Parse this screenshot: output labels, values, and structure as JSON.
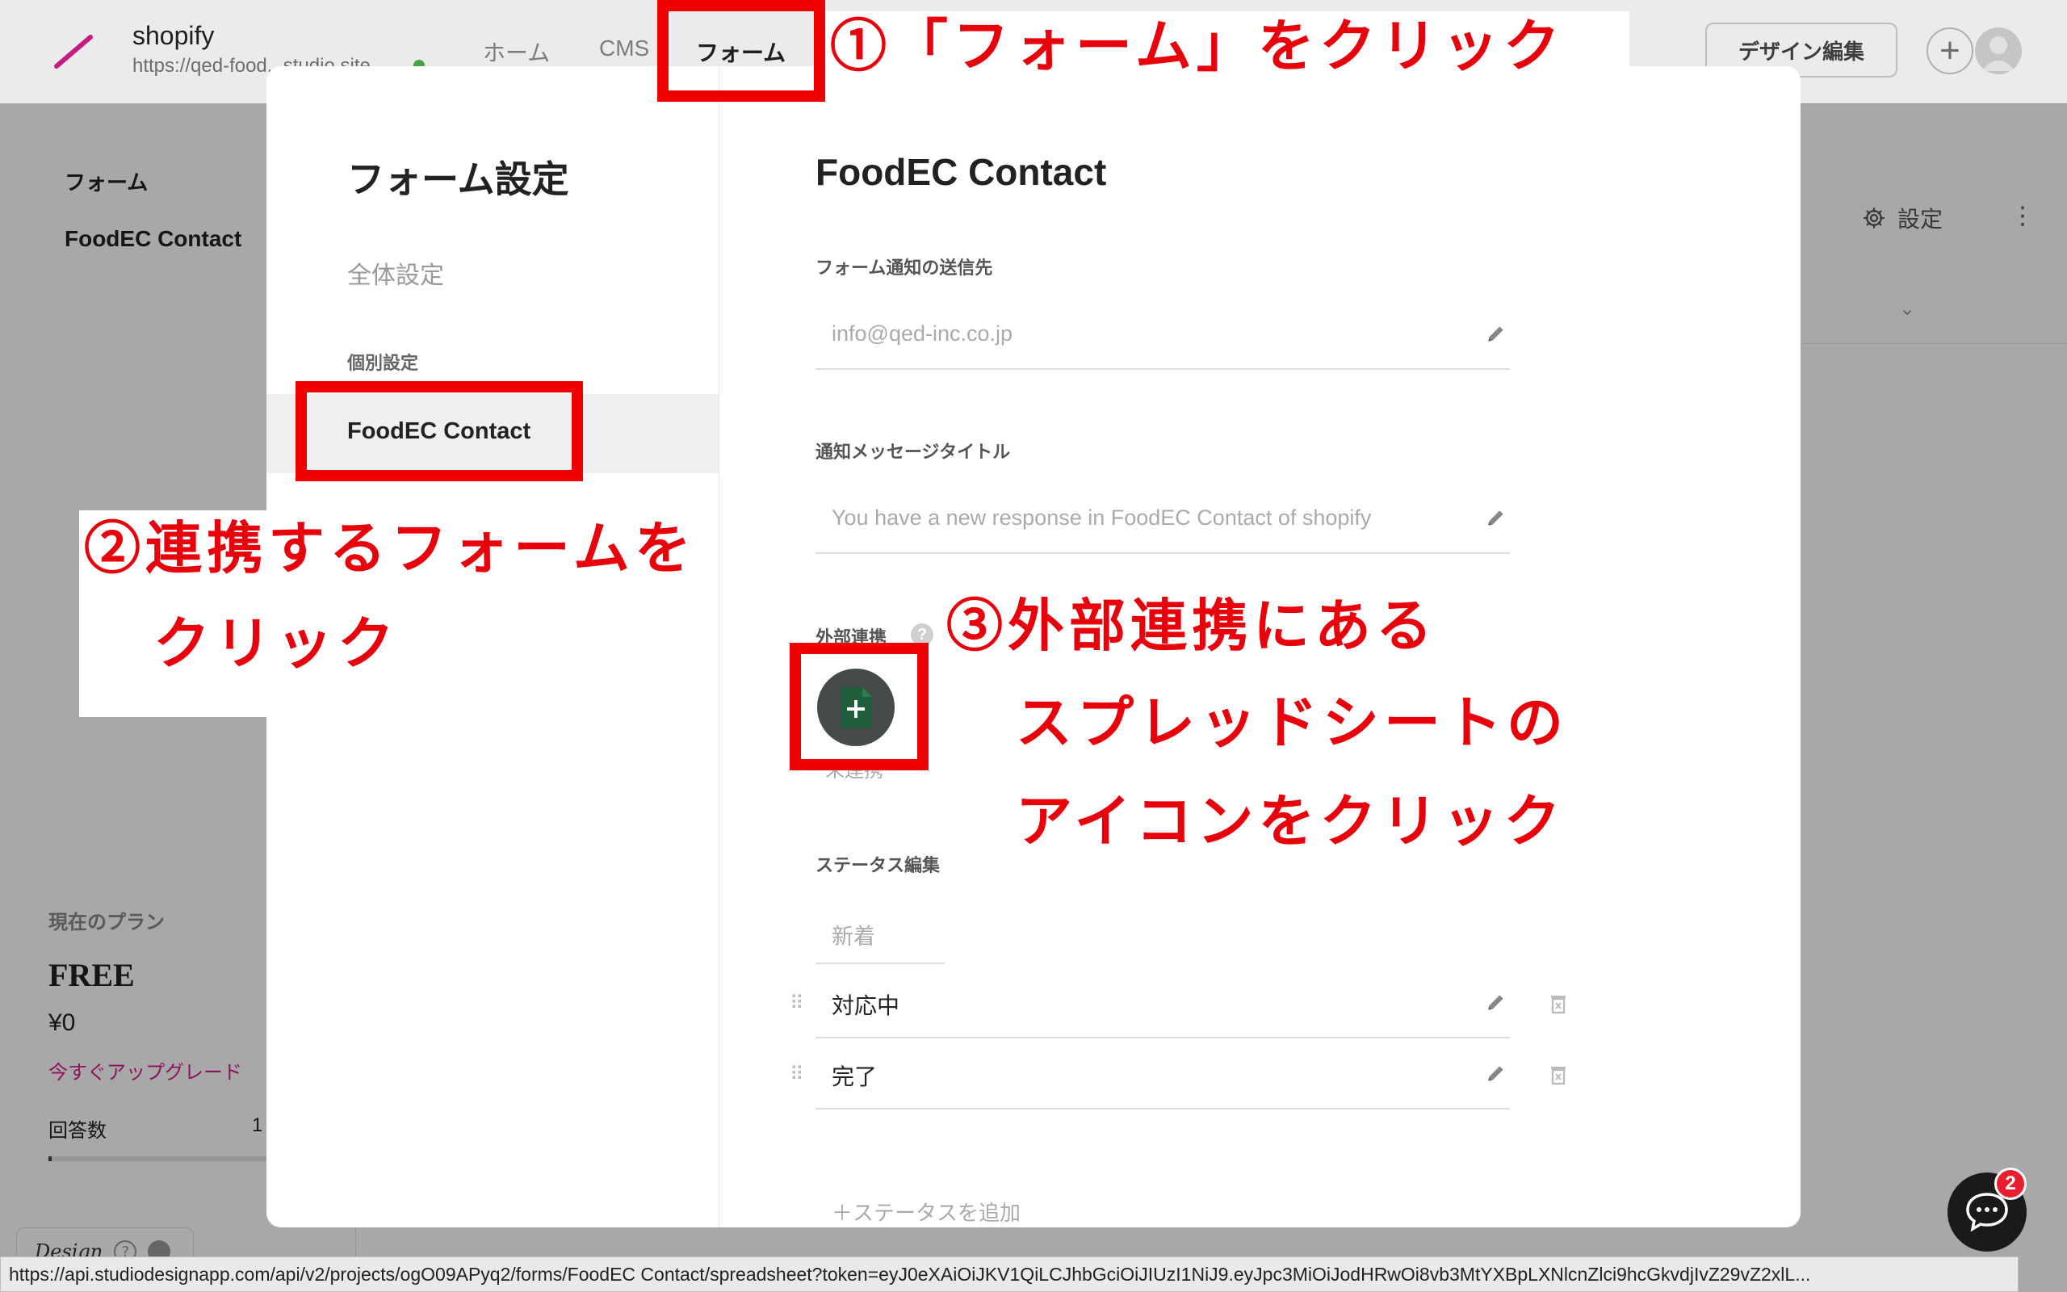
{
  "header": {
    "site_name": "shopify",
    "site_url": "https://qed-food...studio.site",
    "nav": [
      "ホーム",
      "CMS",
      "フォーム"
    ],
    "design_button": "デザイン編集",
    "plus": "+"
  },
  "sidebar": {
    "title": "フォーム",
    "form_item": "FoodEC Contact",
    "plan_label": "現在のプラン",
    "plan_name": "FREE",
    "plan_price": "¥0",
    "upgrade_link": "今すぐアップグレード",
    "answers_label": "回答数",
    "answers_value": "1",
    "design_badge": "Design",
    "help": "?"
  },
  "background_main": {
    "settings_label": "設定",
    "more": "⋮",
    "chevron": "⌄"
  },
  "modal": {
    "heading": "フォーム設定",
    "general": "全体設定",
    "individual_label": "個別設定",
    "form_item": "FoodEC Contact",
    "content_title": "FoodEC Contact",
    "notify_label": "フォーム通知の送信先",
    "notify_value": "info@qed-inc.co.jp",
    "message_title_label": "通知メッセージタイトル",
    "message_title_value": "You have a new response in FoodEC Contact of shopify",
    "external_label": "外部連携",
    "help": "?",
    "unlinked": "未連携",
    "status_label": "ステータス編集",
    "status_new": "新着",
    "status_items": [
      "対応中",
      "完了"
    ],
    "add_status": "＋ステータスを追加",
    "drag_handle": "⠿"
  },
  "chat": {
    "badge": "2"
  },
  "status_bar": {
    "url": "https://api.studiodesignapp.com/api/v2/projects/ogO09APyq2/forms/FoodEC Contact/spreadsheet?token=eyJ0eXAiOiJKV1QiLCJhbGciOiJIUzI1NiJ9.eyJpc3MiOiJodHRwOi8vb3MtYXBpLXNlcnZlci9hcGkvdjIvZ29vZ2xlL..."
  },
  "annotations": {
    "step1": "①「フォーム」をクリック",
    "step2_line1": "②連携するフォームを",
    "step2_line2": "クリック",
    "step3_line1": "③外部連携にある",
    "step3_line2": "スプレッドシートの",
    "step3_line3": "アイコンをクリック"
  },
  "colors": {
    "annotation_red": "#ee0000",
    "brand_pink": "#d41f8e",
    "chat_badge": "#e91e2f"
  }
}
